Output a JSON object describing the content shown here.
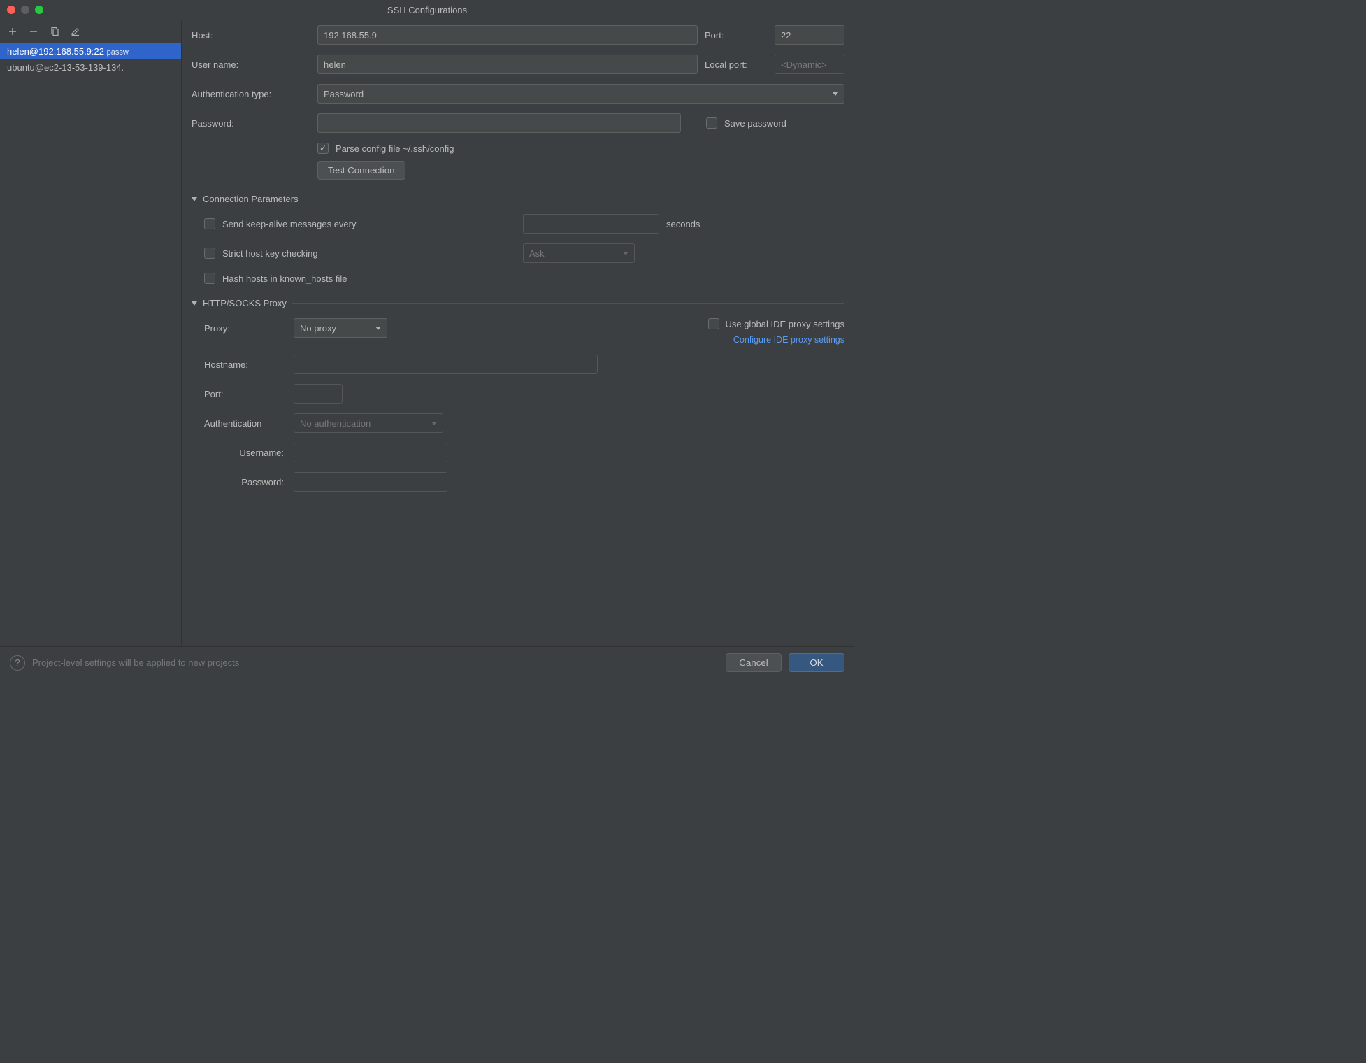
{
  "window": {
    "title": "SSH Configurations"
  },
  "sidebar": {
    "items": [
      {
        "label": "helen@192.168.55.9:22",
        "suffix": "passw",
        "selected": true
      },
      {
        "label": "ubuntu@ec2-13-53-139-134.",
        "suffix": "",
        "selected": false
      }
    ]
  },
  "form": {
    "host_label": "Host:",
    "host_value": "192.168.55.9",
    "port_label": "Port:",
    "port_value": "22",
    "username_label": "User name:",
    "username_value": "helen",
    "local_port_label": "Local port:",
    "local_port_placeholder": "<Dynamic>",
    "auth_type_label": "Authentication type:",
    "auth_type_value": "Password",
    "password_label": "Password:",
    "password_value": "",
    "save_password_label": "Save password",
    "parse_config_label": "Parse config file ~/.ssh/config",
    "test_connection_label": "Test Connection"
  },
  "connection_params": {
    "title": "Connection Parameters",
    "keep_alive_label": "Send keep-alive messages every",
    "keep_alive_value": "",
    "seconds_label": "seconds",
    "strict_label": "Strict host key checking",
    "strict_value": "Ask",
    "hash_label": "Hash hosts in known_hosts file"
  },
  "proxy": {
    "title": "HTTP/SOCKS Proxy",
    "proxy_label": "Proxy:",
    "proxy_value": "No proxy",
    "use_global_label": "Use global IDE proxy settings",
    "configure_link": "Configure IDE proxy settings",
    "hostname_label": "Hostname:",
    "port_label": "Port:",
    "auth_label": "Authentication",
    "auth_value": "No authentication",
    "username_label": "Username:",
    "password_label": "Password:"
  },
  "footer": {
    "hint": "Project-level settings will be applied to new projects",
    "cancel": "Cancel",
    "ok": "OK"
  }
}
